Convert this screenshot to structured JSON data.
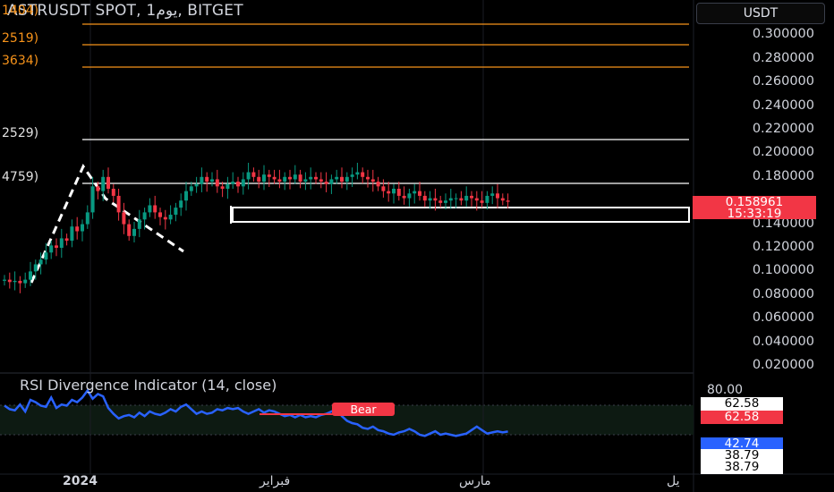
{
  "header": {
    "title": "ASTRUSDT SPOT, 1يوم, BITGET",
    "currency": "USDT"
  },
  "level_labels": [
    {
      "text": "1404)",
      "color": "orange"
    },
    {
      "text": "2519)",
      "color": "orange"
    },
    {
      "text": "3634)",
      "color": "orange"
    },
    {
      "text": "2529)",
      "color": "white"
    },
    {
      "text": "4759)",
      "color": "white"
    }
  ],
  "price_axis": {
    "ticks": [
      "0.300000",
      "0.280000",
      "0.260000",
      "0.240000",
      "0.220000",
      "0.200000",
      "0.180000",
      "0.140000",
      "0.120000",
      "0.100000",
      "0.080000",
      "0.060000",
      "0.040000",
      "0.020000"
    ],
    "current_price": "0.158961",
    "countdown": "15:33:19"
  },
  "rsi": {
    "title": "RSI Divergence Indicator (14, close)",
    "top_tick": "80.00",
    "tags": [
      {
        "text": "62.58",
        "style": "white"
      },
      {
        "text": "62.58",
        "style": "red"
      },
      {
        "text": "42.74",
        "style": "blue"
      },
      {
        "text": "38.79",
        "style": "white"
      },
      {
        "text": "38.79",
        "style": "white"
      }
    ],
    "bear_label": "Bear"
  },
  "time_axis": {
    "labels": [
      "2024",
      "فبراير",
      "مارس",
      "يل"
    ]
  },
  "colors": {
    "background": "#000000",
    "up": "#089981",
    "down": "#f23645",
    "rsi_line": "#2962ff",
    "level_orange": "#f7931a",
    "level_white": "#ffffff"
  },
  "chart_data": {
    "type": "candlestick",
    "symbol": "ASTRUSDT",
    "interval": "1D",
    "ylim": [
      0.02,
      0.3
    ],
    "close": [
      0.093,
      0.091,
      0.092,
      0.09,
      0.093,
      0.1,
      0.106,
      0.11,
      0.116,
      0.122,
      0.12,
      0.128,
      0.126,
      0.138,
      0.134,
      0.14,
      0.15,
      0.172,
      0.168,
      0.18,
      0.17,
      0.164,
      0.15,
      0.14,
      0.13,
      0.136,
      0.144,
      0.15,
      0.156,
      0.15,
      0.146,
      0.144,
      0.148,
      0.154,
      0.16,
      0.168,
      0.172,
      0.174,
      0.18,
      0.176,
      0.178,
      0.172,
      0.17,
      0.174,
      0.176,
      0.172,
      0.178,
      0.184,
      0.18,
      0.176,
      0.182,
      0.18,
      0.178,
      0.176,
      0.18,
      0.178,
      0.182,
      0.176,
      0.178,
      0.18,
      0.178,
      0.176,
      0.174,
      0.178,
      0.18,
      0.176,
      0.18,
      0.182,
      0.184,
      0.18,
      0.178,
      0.176,
      0.172,
      0.168,
      0.166,
      0.17,
      0.164,
      0.162,
      0.166,
      0.168,
      0.164,
      0.16,
      0.162,
      0.16,
      0.158,
      0.16,
      0.162,
      0.162,
      0.16,
      0.164,
      0.162,
      0.16,
      0.158,
      0.164,
      0.166,
      0.162,
      0.16,
      0.158961
    ],
    "rsi": [
      65,
      62,
      61,
      66,
      60,
      70,
      68,
      65,
      64,
      72,
      63,
      66,
      65,
      70,
      68,
      72,
      78,
      71,
      75,
      73,
      63,
      58,
      54,
      56,
      57,
      55,
      59,
      56,
      60,
      58,
      57,
      59,
      62,
      60,
      64,
      66,
      62,
      58,
      60,
      58,
      59,
      62,
      61,
      63,
      62,
      63,
      60,
      58,
      60,
      62,
      59,
      61,
      60,
      58,
      56,
      57,
      55,
      57,
      55,
      56,
      55,
      57,
      58,
      60,
      62,
      56,
      52,
      50,
      49,
      46,
      45,
      47,
      44,
      43,
      41,
      40,
      42,
      43,
      45,
      43,
      40,
      39,
      41,
      43,
      40,
      41,
      40,
      39,
      40,
      41,
      44,
      47,
      44,
      41,
      42,
      43,
      42,
      42.74
    ]
  }
}
